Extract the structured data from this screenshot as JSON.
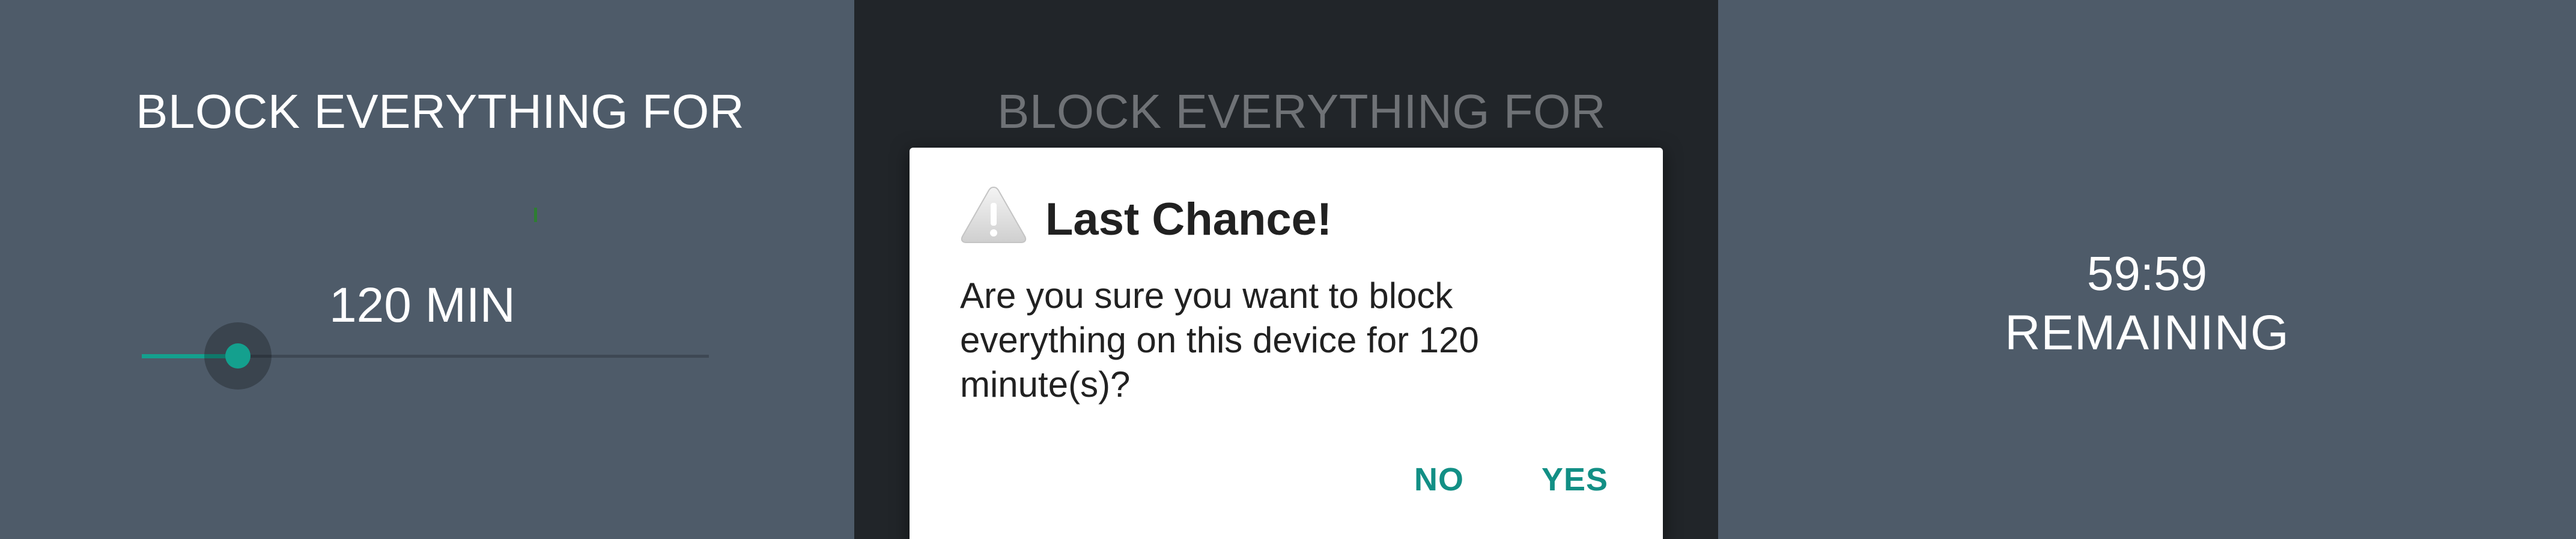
{
  "screens": {
    "duration_picker": {
      "heading": "BLOCK EVERYTHING FOR",
      "minutes_label": "120 MIN",
      "slider_fraction": 0.17
    },
    "confirm_dialog": {
      "heading": "BLOCK EVERYTHING FOR",
      "title": "Last Chance!",
      "message": "Are you sure you want to block everything on this device for 120 minute(s)?",
      "no_label": "NO",
      "yes_label": "YES",
      "icon": "warning-triangle-icon"
    },
    "countdown": {
      "time_remaining": "59:59",
      "remaining_label": "REMAINING"
    }
  },
  "colors": {
    "panel_background": "#4e5b69",
    "dim_background": "#212529",
    "accent": "#14a08e",
    "button_text": "#128f85"
  }
}
